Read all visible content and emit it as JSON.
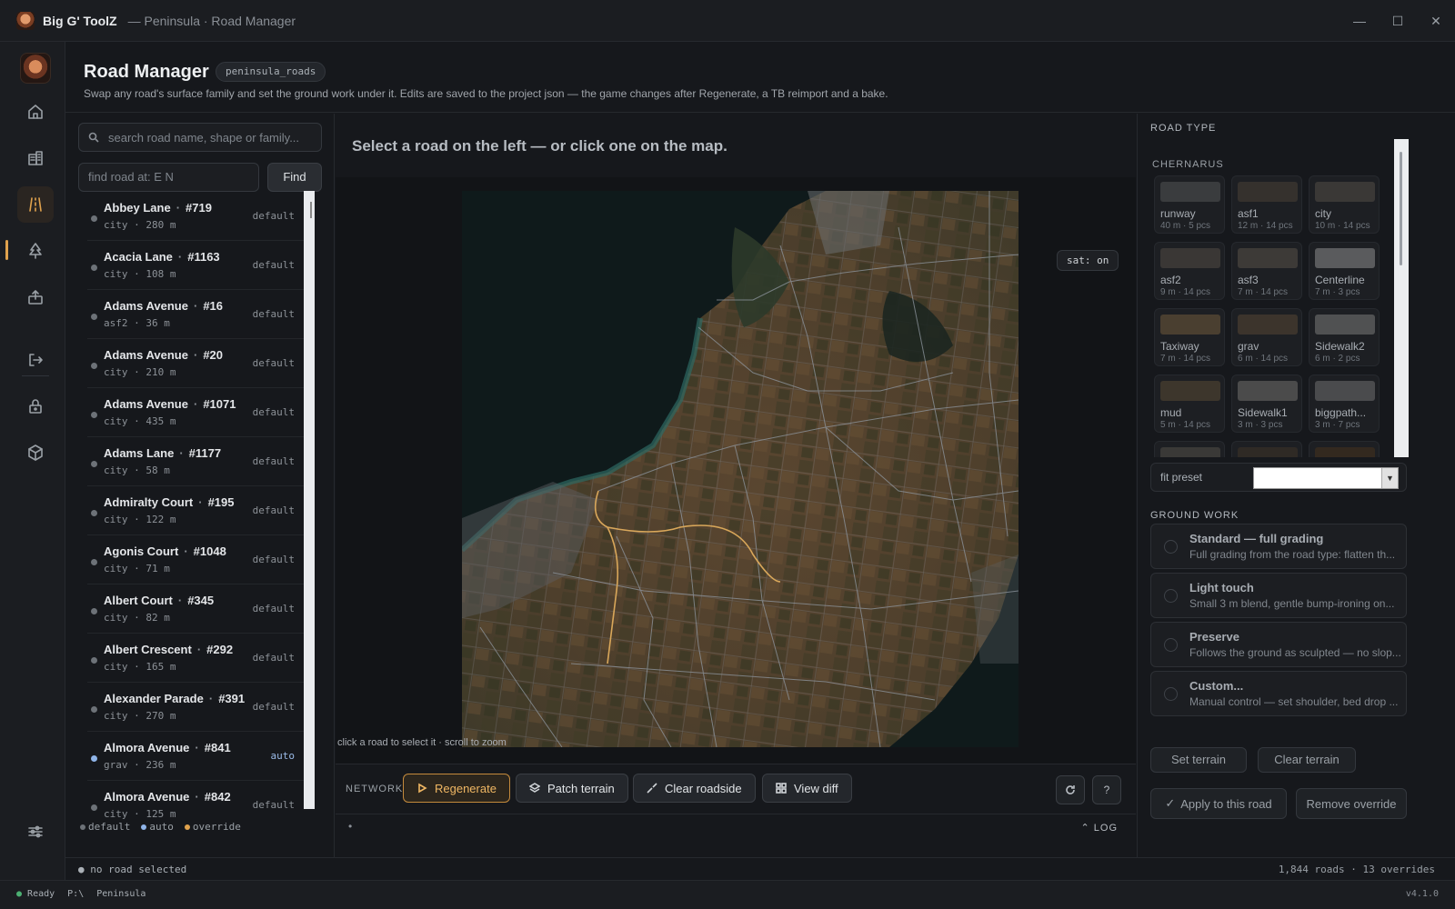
{
  "window": {
    "app_name": "Big G' ToolZ",
    "subtitle": "— Peninsula · Road Manager",
    "minimize": "—",
    "maximize": "☐",
    "close": "✕"
  },
  "header": {
    "title": "Road Manager",
    "tag": "peninsula_roads",
    "description": "Swap any road's surface family and set the ground work under it. Edits are saved to the project json — the game changes after Regenerate, a TB reimport and a bake."
  },
  "search": {
    "placeholder": "search road name, shape or family...",
    "find_placeholder": "find road at:  E N",
    "find_label": "Find"
  },
  "roads": [
    {
      "name": "Abbey Lane",
      "id": "#719",
      "meta": "city · 280 m",
      "status": "default"
    },
    {
      "name": "Acacia Lane",
      "id": "#1163",
      "meta": "city · 108 m",
      "status": "default"
    },
    {
      "name": "Adams Avenue",
      "id": "#16",
      "meta": "asf2 · 36 m",
      "status": "default"
    },
    {
      "name": "Adams Avenue",
      "id": "#20",
      "meta": "city · 210 m",
      "status": "default"
    },
    {
      "name": "Adams Avenue",
      "id": "#1071",
      "meta": "city · 435 m",
      "status": "default"
    },
    {
      "name": "Adams Lane",
      "id": "#1177",
      "meta": "city · 58 m",
      "status": "default"
    },
    {
      "name": "Admiralty Court",
      "id": "#195",
      "meta": "city · 122 m",
      "status": "default"
    },
    {
      "name": "Agonis Court",
      "id": "#1048",
      "meta": "city · 71 m",
      "status": "default"
    },
    {
      "name": "Albert Court",
      "id": "#345",
      "meta": "city · 82 m",
      "status": "default"
    },
    {
      "name": "Albert Crescent",
      "id": "#292",
      "meta": "city · 165 m",
      "status": "default"
    },
    {
      "name": "Alexander Parade",
      "id": "#391",
      "meta": "city · 270 m",
      "status": "default"
    },
    {
      "name": "Almora Avenue",
      "id": "#841",
      "meta": "grav · 236 m",
      "status": "auto"
    },
    {
      "name": "Almora Avenue",
      "id": "#842",
      "meta": "city · 125 m",
      "status": "default"
    }
  ],
  "legend": {
    "default": "default",
    "auto": "auto",
    "override": "override"
  },
  "legend_colors": {
    "default": "#6d7278",
    "auto": "#8fb4e8",
    "override": "#e0a24d"
  },
  "center": {
    "prompt": "Select a road on the left — or click one on the map.",
    "sat_badge": "sat: on",
    "map_hint": "click a road to select it · scroll to zoom"
  },
  "actions": {
    "network_label": "NETWORK",
    "regenerate": "Regenerate",
    "patch_terrain": "Patch terrain",
    "clear_roadside": "Clear roadside",
    "view_diff": "View diff",
    "help": "?"
  },
  "log": {
    "bullet": "•",
    "label": "LOG"
  },
  "right": {
    "road_type_title": "ROAD TYPE",
    "group": "CHERNARUS",
    "tiles": [
      {
        "name": "runway",
        "meta": "40 m · 5 pcs",
        "color": "#3a3c3e"
      },
      {
        "name": "asf1",
        "meta": "12 m · 14 pcs",
        "color": "#35312d"
      },
      {
        "name": "city",
        "meta": "10 m · 14 pcs",
        "color": "#3a3836"
      },
      {
        "name": "asf2",
        "meta": "9 m · 14 pcs",
        "color": "#3a3735"
      },
      {
        "name": "asf3",
        "meta": "7 m · 14 pcs",
        "color": "#3d3a37"
      },
      {
        "name": "Centerline",
        "meta": "7 m · 3 pcs",
        "color": "#5a5b5d"
      },
      {
        "name": "Taxiway",
        "meta": "7 m · 14 pcs",
        "color": "#4a3f30"
      },
      {
        "name": "grav",
        "meta": "6 m · 14 pcs",
        "color": "#3c342c"
      },
      {
        "name": "Sidewalk2",
        "meta": "6 m · 2 pcs",
        "color": "#505152"
      },
      {
        "name": "mud",
        "meta": "5 m · 14 pcs",
        "color": "#3d362c"
      },
      {
        "name": "Sidewalk1",
        "meta": "3 m · 3 pcs",
        "color": "#4b4b4b"
      },
      {
        "name": "biggpath...",
        "meta": "3 m · 7 pcs",
        "color": "#4a4b4d"
      },
      {
        "name": "",
        "meta": "",
        "color": "#3a3937"
      },
      {
        "name": "",
        "meta": "",
        "color": "#2f2a25"
      },
      {
        "name": "",
        "meta": "",
        "color": "#33291f"
      }
    ],
    "fit_preset_label": "fit preset",
    "fit_preset_value": "",
    "ground_work_title": "GROUND WORK",
    "ground_work": [
      {
        "title": "Standard — full grading",
        "desc": "Full grading from the road type: flatten th..."
      },
      {
        "title": "Light touch",
        "desc": "Small 3 m blend, gentle bump-ironing on..."
      },
      {
        "title": "Preserve",
        "desc": "Follows the ground as sculpted — no slop..."
      },
      {
        "title": "Custom...",
        "desc": "Manual control — set shoulder, bed drop ..."
      }
    ],
    "set_terrain": "Set terrain",
    "clear_terrain": "Clear terrain",
    "apply": "Apply to this road",
    "remove_override": "Remove override"
  },
  "status": {
    "selection": "● no road selected",
    "counts": "1,844 roads · 13 overrides",
    "ready": "Ready",
    "drive": "P:\\",
    "project": "Peninsula",
    "version": "v4.1.0"
  }
}
